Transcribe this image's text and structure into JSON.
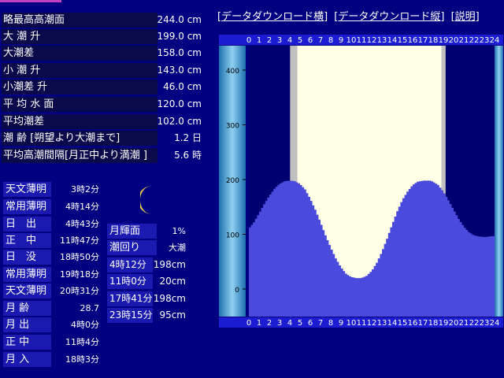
{
  "links": [
    "[データダウンロード横]",
    "[データダウンロード縦]",
    "[説明]"
  ],
  "summary": [
    {
      "label": "略最高高潮面",
      "value": "244.0 cm"
    },
    {
      "label": "大 潮 升",
      "value": "199.0 cm"
    },
    {
      "label": "大潮差",
      "value": "158.0 cm"
    },
    {
      "label": "小 潮 升",
      "value": "143.0 cm"
    },
    {
      "label": "小潮差 升",
      "value": "46.0 cm"
    },
    {
      "label": "平 均 水 面",
      "value": "120.0 cm"
    },
    {
      "label": "平均潮差",
      "value": "102.0 cm"
    },
    {
      "label": "潮 齢 [朔望より大潮まで]",
      "value": "1.2 日"
    },
    {
      "label": "平均高潮間隔[月正中より満潮 ]",
      "value": "5.6 時"
    }
  ],
  "astro": [
    {
      "label": "天文薄明",
      "value": "3時2分"
    },
    {
      "label": "常用薄明",
      "value": "4時14分"
    },
    {
      "label": "日　出",
      "value": "4時43分"
    },
    {
      "label": "正　中",
      "value": "11時47分"
    },
    {
      "label": "日　没",
      "value": "18時50分"
    },
    {
      "label": "常用薄明",
      "value": "19時18分"
    },
    {
      "label": "天文薄明",
      "value": "20時31分"
    },
    {
      "label": "月 齢",
      "value": "28.7"
    },
    {
      "label": "月 出",
      "value": "4時0分"
    },
    {
      "label": "正 中",
      "value": "11時4分"
    },
    {
      "label": "月 入",
      "value": "18時3分"
    }
  ],
  "moon": {
    "glow_label": "月輝面",
    "glow_value": "1%",
    "tide_label": "潮回り",
    "tide_value": "大潮"
  },
  "tides": [
    {
      "time": "4時12分",
      "level": "198cm"
    },
    {
      "time": "11時0分",
      "level": "20cm"
    },
    {
      "time": "17時41分",
      "level": "198cm"
    },
    {
      "time": "23時15分",
      "level": "95cm"
    }
  ],
  "chart_data": {
    "type": "area",
    "x_ticks": [
      "0",
      "1",
      "2",
      "3",
      "4",
      "5",
      "6",
      "7",
      "8",
      "9",
      "10",
      "11",
      "12",
      "13",
      "14",
      "15",
      "16",
      "17",
      "18",
      "19",
      "20",
      "21",
      "22",
      "23",
      "24"
    ],
    "y_ticks": [
      "400",
      "300",
      "200",
      "100",
      "0"
    ],
    "ylim": [
      -50,
      450
    ],
    "xlim": [
      0,
      24
    ],
    "daylight": [
      4.717,
      18.833
    ],
    "series": [
      {
        "x": [
          0,
          0.5,
          1,
          1.5,
          2,
          2.5,
          3,
          3.5,
          4,
          4.2,
          4.5,
          5,
          5.5,
          6,
          6.5,
          7,
          7.5,
          8,
          8.5,
          9,
          9.5,
          10,
          10.5,
          11,
          11.5,
          12,
          12.5,
          13,
          13.5,
          14,
          14.5,
          15,
          15.5,
          16,
          16.5,
          17,
          17.7,
          18,
          18.5,
          19,
          19.5,
          20,
          20.5,
          21,
          21.5,
          22,
          22.5,
          23,
          23.25,
          23.5,
          24
        ],
        "y": [
          110,
          122,
          138,
          155,
          170,
          183,
          192,
          197,
          198,
          198,
          197,
          192,
          182,
          165,
          145,
          122,
          98,
          76,
          56,
          40,
          28,
          22,
          20,
          20,
          24,
          33,
          48,
          68,
          92,
          118,
          142,
          163,
          178,
          190,
          196,
          198,
          198,
          196,
          190,
          178,
          162,
          145,
          128,
          114,
          104,
          98,
          96,
          95,
          95,
          96,
          97
        ]
      }
    ]
  },
  "colors": {
    "background": "#000080",
    "daylight": "#ffffe6",
    "water": "#4a4adc",
    "chart_bg": "#000070",
    "grid": "#c0c0c0",
    "axis_band": "#1c1cd2",
    "gauge": "#3fa0d8"
  }
}
